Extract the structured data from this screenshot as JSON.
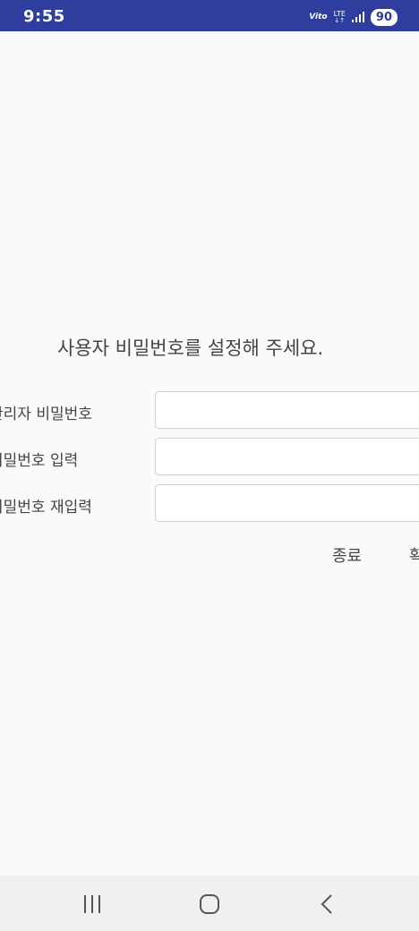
{
  "status_bar": {
    "time": "9:55",
    "volte_label": "Vito",
    "network_type": "LTE",
    "network_arrows": "↓↑",
    "battery_level": "90",
    "signal_icon": "signal-bars-icon",
    "background_color": "#2e3d9e"
  },
  "form": {
    "prompt": "사용자 비밀번호를 설정해 주세요.",
    "fields": [
      {
        "label": "관리자 비밀번호",
        "value": ""
      },
      {
        "label": "비밀번호 입력",
        "value": ""
      },
      {
        "label": "비밀번호 재입력",
        "value": ""
      }
    ]
  },
  "actions": {
    "exit_label": "종료",
    "confirm_label": "확인"
  },
  "nav_bar": {
    "recents_icon": "recents-icon",
    "home_icon": "home-icon",
    "back_icon": "back-icon"
  }
}
